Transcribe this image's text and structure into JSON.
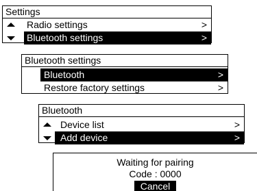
{
  "settings_menu": {
    "title": "Settings",
    "items": [
      {
        "label": "Radio settings",
        "arrow": "up-arrow-icon",
        "chevron": ">"
      },
      {
        "label": "Bluetooth settings",
        "arrow": "down-arrow-icon",
        "chevron": ">",
        "selected": true
      }
    ]
  },
  "bluetooth_settings_menu": {
    "title": "Bluetooth settings",
    "items": [
      {
        "label": "Bluetooth",
        "chevron": ">",
        "selected": true
      },
      {
        "label": "Restore factory settings",
        "chevron": ">"
      }
    ]
  },
  "bluetooth_menu": {
    "title": "Bluetooth",
    "items": [
      {
        "label": "Device list",
        "arrow": "up-arrow-icon",
        "chevron": ">"
      },
      {
        "label": "Add device",
        "arrow": "down-arrow-icon",
        "chevron": ">",
        "selected": true
      }
    ]
  },
  "pairing_dialog": {
    "message": "Waiting for pairing",
    "code": "Code : 0000",
    "cancel_label": "Cancel"
  },
  "colors": {
    "foreground": "#000000",
    "background": "#ffffff",
    "selection_bg": "#000000",
    "selection_fg": "#ffffff"
  }
}
